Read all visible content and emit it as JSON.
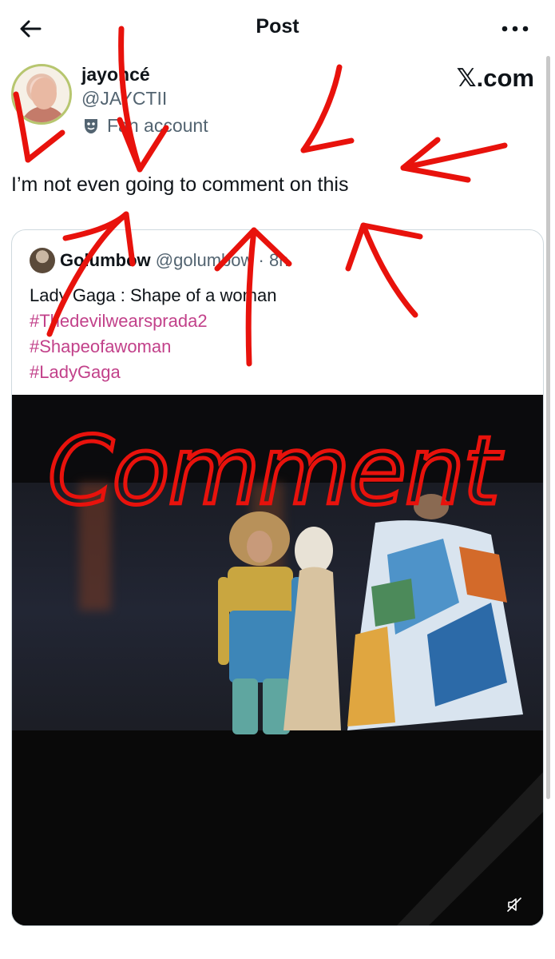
{
  "header": {
    "title": "Post",
    "back_icon": "arrow-left-icon",
    "more_icon": "more-horizontal-icon"
  },
  "author": {
    "display_name": "jayoncé",
    "handle": "@JAYCTII",
    "label": "Fan account",
    "label_icon": "theater-mask-icon"
  },
  "brand": "𝕏.com",
  "post": {
    "text": "I’m not even going to comment on this"
  },
  "quoted_post": {
    "author_name": "Golumbow",
    "handle": "@golumbow",
    "separator": "·",
    "time": "8h",
    "text": "Lady Gaga : Shape of a woman",
    "hashtags": [
      "#Thedevilwearsprada2",
      "#Shapeofawoman",
      "#LadyGaga"
    ]
  },
  "video": {
    "mute_icon": "volume-muted-icon"
  },
  "annotation": {
    "handwritten": "Comment",
    "color": "#e8120c"
  },
  "colors": {
    "hashtag": "#c2418a",
    "muted_text": "#536471",
    "border": "#cfd9de"
  }
}
